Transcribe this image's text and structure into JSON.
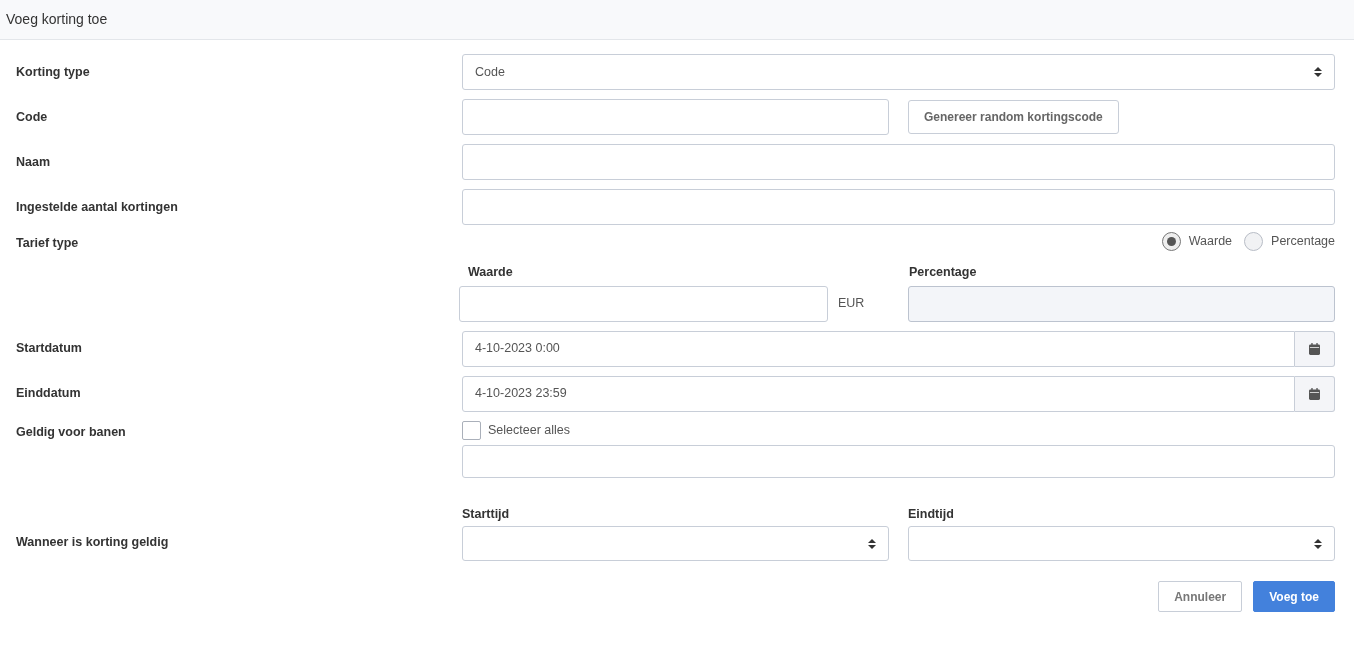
{
  "header": {
    "title": "Voeg korting toe"
  },
  "rows": [
    {
      "kind": "select",
      "label": "Korting type",
      "value": "Code"
    },
    {
      "kind": "text_button",
      "label": "Code",
      "button": "Genereer random kortingscode"
    },
    {
      "kind": "text",
      "label": "Naam"
    },
    {
      "kind": "text",
      "label": "Ingestelde aantal kortingen"
    },
    {
      "kind": "radio",
      "label": "Tarief type",
      "options": [
        {
          "label": "Waarde",
          "selected": true
        },
        {
          "label": "Percentage",
          "selected": false
        }
      ],
      "subfields": [
        {
          "label": "Waarde",
          "unit": "EUR",
          "disabled": false
        },
        {
          "label": "Percentage",
          "disabled": true
        }
      ]
    },
    {
      "kind": "date",
      "label": "Startdatum",
      "value": "4-10-2023 0:00"
    },
    {
      "kind": "date",
      "label": "Einddatum",
      "value": "4-10-2023 23:59"
    },
    {
      "kind": "checklist",
      "label": "Geldig voor banen",
      "checkbox": {
        "label": "Selecteer alles",
        "checked": false
      }
    },
    {
      "kind": "time_range",
      "label": "Wanneer is korting geldig",
      "selects": [
        {
          "label": "Starttijd"
        },
        {
          "label": "Eindtijd"
        }
      ]
    }
  ],
  "buttons": [
    {
      "label": "Annuleer",
      "kind": "secondary"
    },
    {
      "label": "Voeg toe",
      "kind": "primary"
    }
  ]
}
